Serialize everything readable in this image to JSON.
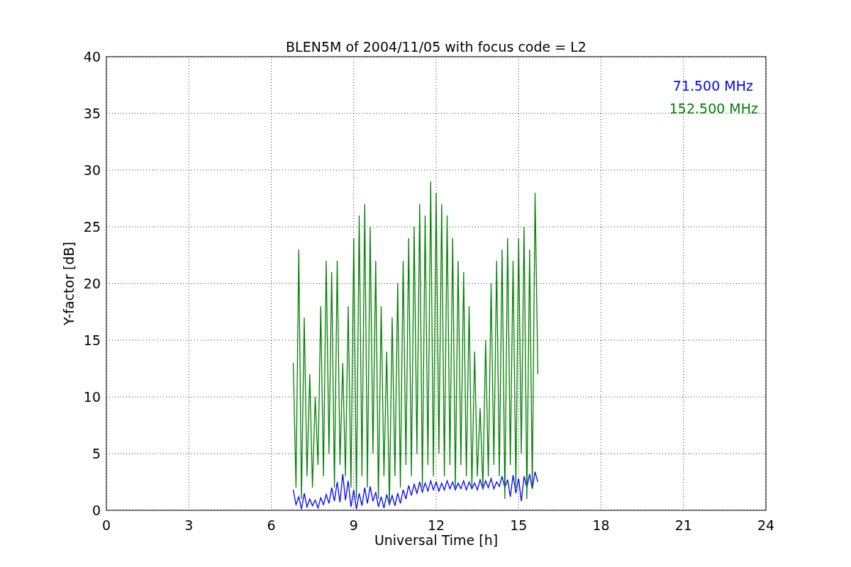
{
  "chart_data": {
    "type": "line",
    "title": "BLEN5M of 2004/11/05 with focus code = L2",
    "xlabel": "Universal Time [h]",
    "ylabel": "Y-factor [dB]",
    "grid": true,
    "xlim": [
      0,
      24
    ],
    "ylim": [
      0,
      40
    ],
    "xticks": [
      0,
      3,
      6,
      9,
      12,
      15,
      18,
      21,
      24
    ],
    "yticks": [
      0,
      5,
      10,
      15,
      20,
      25,
      30,
      35,
      40
    ],
    "x": [
      6.8,
      6.9,
      7.0,
      7.1,
      7.2,
      7.3,
      7.4,
      7.5,
      7.6,
      7.7,
      7.8,
      7.9,
      8.0,
      8.1,
      8.2,
      8.3,
      8.4,
      8.5,
      8.6,
      8.7,
      8.8,
      8.9,
      9.0,
      9.1,
      9.2,
      9.3,
      9.4,
      9.5,
      9.6,
      9.7,
      9.8,
      9.9,
      10.0,
      10.1,
      10.2,
      10.3,
      10.4,
      10.5,
      10.6,
      10.7,
      10.8,
      10.9,
      11.0,
      11.1,
      11.2,
      11.3,
      11.4,
      11.5,
      11.6,
      11.7,
      11.8,
      11.9,
      12.0,
      12.1,
      12.2,
      12.3,
      12.4,
      12.5,
      12.6,
      12.7,
      12.8,
      12.9,
      13.0,
      13.1,
      13.2,
      13.3,
      13.4,
      13.5,
      13.6,
      13.7,
      13.8,
      13.9,
      14.0,
      14.1,
      14.2,
      14.3,
      14.4,
      14.5,
      14.6,
      14.7,
      14.8,
      14.9,
      15.0,
      15.1,
      15.2,
      15.3,
      15.4,
      15.5,
      15.6,
      15.7
    ],
    "series": [
      {
        "name": "71.500 MHz",
        "color": "#0000ff",
        "values": [
          1.8,
          0.5,
          1.2,
          0.1,
          1.5,
          0.3,
          1,
          0.4,
          0.9,
          0.2,
          1.1,
          0.5,
          1.4,
          0.6,
          2,
          0.8,
          2.5,
          0.7,
          3.2,
          0.9,
          2.6,
          0.3,
          1.8,
          0.1,
          1.5,
          0.4,
          2,
          0.6,
          2.1,
          0.8,
          1.6,
          0.3,
          1.2,
          0.2,
          1.4,
          0.5,
          1.3,
          0.4,
          1.5,
          0.6,
          1.8,
          1,
          2.2,
          1.3,
          2.3,
          1.5,
          2.5,
          1.6,
          2.4,
          1.7,
          2.6,
          1.8,
          2.5,
          1.7,
          2.4,
          1.8,
          2.6,
          1.9,
          2.5,
          1.8,
          2.4,
          1.9,
          2.6,
          1.8,
          2.5,
          1.9,
          2.4,
          1.8,
          2.7,
          1.9,
          2.6,
          2,
          2.8,
          1.9,
          2.5,
          2.1,
          3,
          2,
          2.7,
          1.2,
          3.1,
          1.5,
          2.8,
          0.8,
          3,
          2,
          3.2,
          1.9,
          3.4,
          2.5
        ]
      },
      {
        "name": "152.500 MHz",
        "color": "#008000",
        "values": [
          13,
          2,
          23,
          1,
          17,
          3,
          12,
          2,
          10,
          4,
          18,
          3,
          22,
          5,
          21,
          2,
          22,
          4,
          13,
          3,
          18,
          2,
          24,
          1,
          26,
          3,
          27,
          2,
          25,
          5,
          22,
          1,
          18,
          3,
          14,
          0.5,
          17,
          3,
          20,
          2,
          22,
          4,
          24,
          3,
          25,
          5,
          27,
          2,
          26,
          4,
          29,
          3,
          28,
          5,
          27,
          3,
          26,
          4,
          24,
          2,
          22,
          4,
          21,
          3,
          18,
          2,
          14,
          3,
          9,
          2,
          15,
          3,
          20,
          4,
          22,
          3,
          23,
          1,
          24,
          4,
          22,
          2,
          24,
          5,
          25,
          1,
          23,
          2,
          28,
          12
        ]
      }
    ]
  }
}
